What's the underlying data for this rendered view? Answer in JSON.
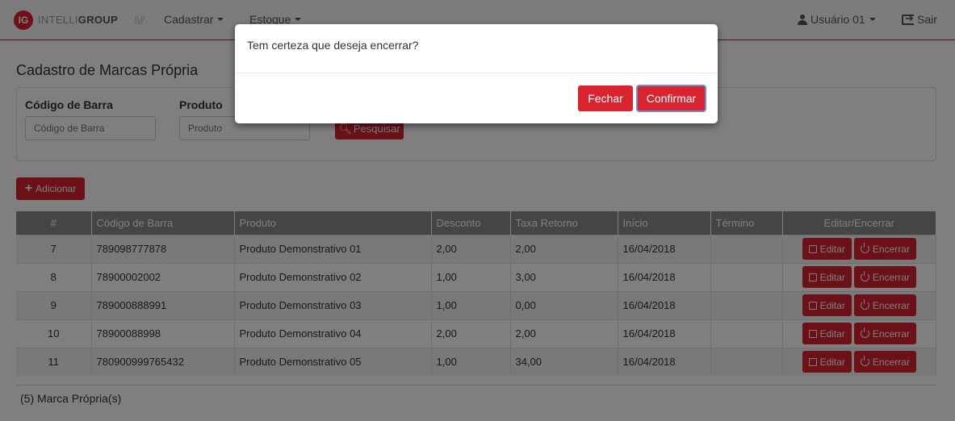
{
  "brand": {
    "badge": "IG",
    "name_light": "INTELLI",
    "name_bold": "GROUP",
    "secondary_logo": "\\\\//"
  },
  "nav": {
    "cadastrar": "Cadastrar",
    "estoque": "Estoque",
    "user": "Usuário 01",
    "logout": "Sair"
  },
  "page": {
    "title": "Cadastro de Marcas Própria"
  },
  "filter": {
    "barcode_label": "Código de Barra",
    "barcode_placeholder": "Código de Barra",
    "product_label": "Produto",
    "product_placeholder": "Produto",
    "search_label": "Pesquisar"
  },
  "add_button": "Adicionar",
  "table": {
    "headers": [
      "#",
      "Código de Barra",
      "Produto",
      "Desconto",
      "Taxa Retorno",
      "Início",
      "Término",
      "Editar/Encerrar"
    ],
    "edit_label": "Editar",
    "close_label": "Encerrar",
    "rows": [
      {
        "id": "7",
        "barcode": "789098777878",
        "product": "Produto Demonstrativo 01",
        "discount": "2,00",
        "rate": "2,00",
        "start": "16/04/2018",
        "end": ""
      },
      {
        "id": "8",
        "barcode": "78900002002",
        "product": "Produto Demonstrativo 02",
        "discount": "1,00",
        "rate": "3,00",
        "start": "16/04/2018",
        "end": ""
      },
      {
        "id": "9",
        "barcode": "789000888991",
        "product": "Produto Demonstrativo 03",
        "discount": "1,00",
        "rate": "0,00",
        "start": "16/04/2018",
        "end": ""
      },
      {
        "id": "10",
        "barcode": "78900088998",
        "product": "Produto Demonstrativo 04",
        "discount": "2,00",
        "rate": "2,00",
        "start": "16/04/2018",
        "end": ""
      },
      {
        "id": "11",
        "barcode": "780900999765432",
        "product": "Produto Demonstrativo 05",
        "discount": "1,00",
        "rate": "34,00",
        "start": "16/04/2018",
        "end": ""
      }
    ]
  },
  "footer": {
    "count": "(5) Marca Própria(s)"
  },
  "modal": {
    "message": "Tem certeza que deseja encerrar?",
    "close_label": "Fechar",
    "confirm_label": "Confirmar"
  },
  "colors": {
    "accent": "#d9232e",
    "table_header": "#8a8a8a",
    "overlay": "rgba(0,0,0,0.5)"
  }
}
